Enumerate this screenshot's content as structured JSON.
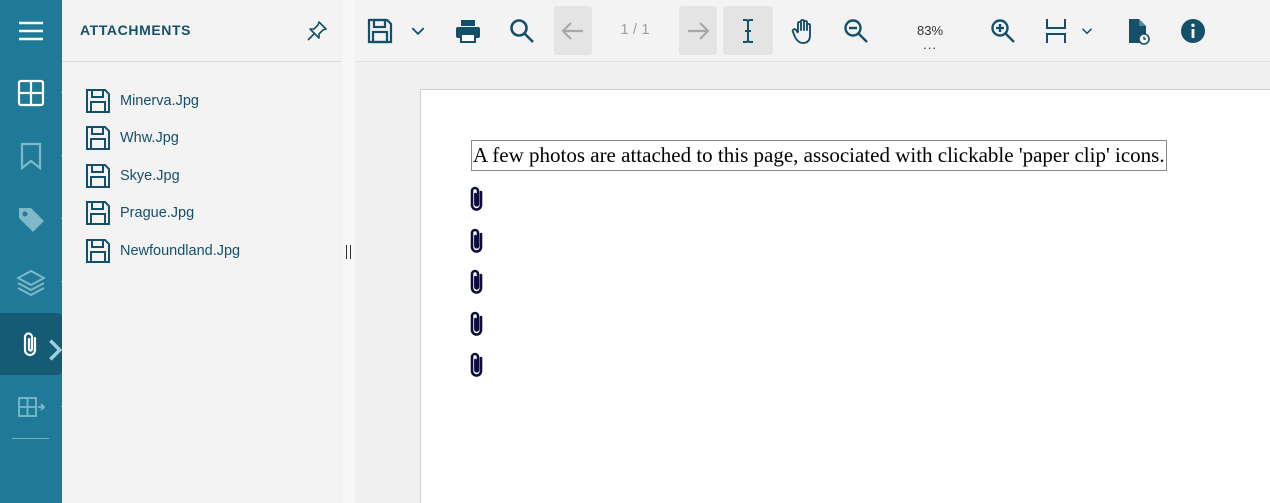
{
  "panel": {
    "title": "ATTACHMENTS",
    "attachments": [
      {
        "name": "Minerva.Jpg"
      },
      {
        "name": "Whw.Jpg"
      },
      {
        "name": "Skye.Jpg"
      },
      {
        "name": "Prague.Jpg"
      },
      {
        "name": "Newfoundland.Jpg"
      }
    ]
  },
  "toolbar": {
    "page_indicator": "1 / 1",
    "zoom": "83%",
    "zoom_more": "..."
  },
  "document": {
    "text": "A few photos are attached to this page, associated with clickable 'paper clip' icons."
  },
  "colors": {
    "rail": "#1e7a96",
    "rail_active": "#145b73",
    "icon_dark": "#15506a"
  }
}
